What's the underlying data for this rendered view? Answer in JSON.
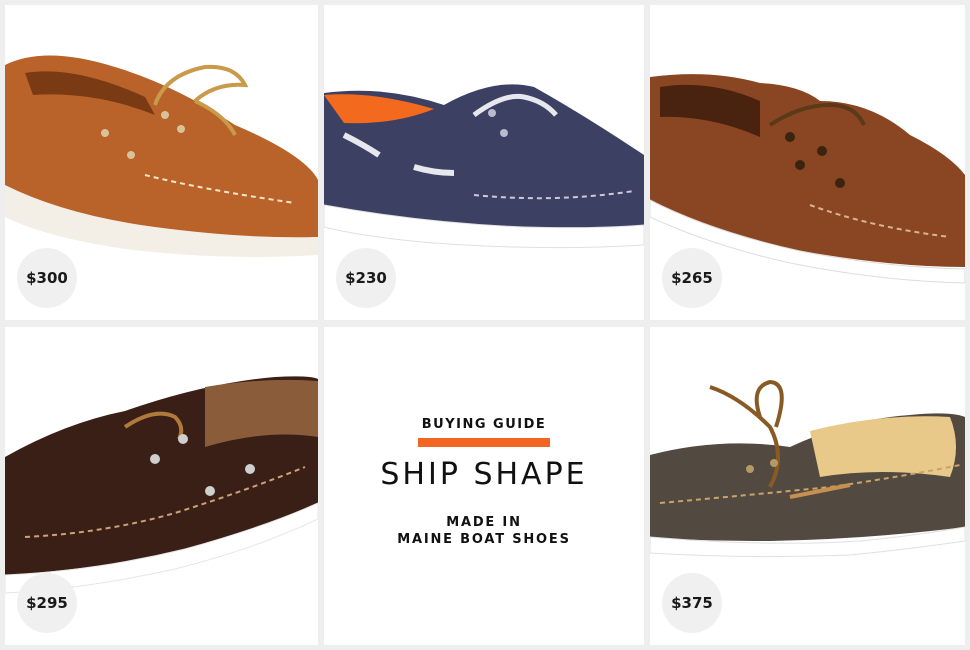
{
  "colors": {
    "accent": "#f26522",
    "price_badge_bg": "#f0f0f0",
    "text": "#111111"
  },
  "tiles": [
    {
      "name": "tan-leather-boat-shoe",
      "price": "$300"
    },
    {
      "name": "navy-leather-boat-shoe",
      "price": "$230"
    },
    {
      "name": "brown-leather-boat-shoe",
      "price": "$265"
    },
    {
      "name": "dark-brown-leather-boat-shoe",
      "price": "$295"
    },
    {
      "name": "grey-suede-boat-shoe",
      "price": "$375"
    }
  ],
  "guide": {
    "kicker": "BUYING GUIDE",
    "title": "SHIP SHAPE",
    "subtitle_line1": "MADE IN",
    "subtitle_line2": "MAINE BOAT SHOES"
  }
}
